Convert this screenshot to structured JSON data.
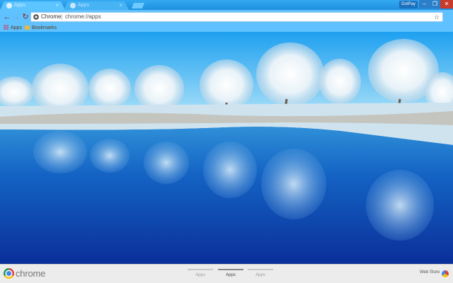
{
  "tabs": [
    {
      "title": "Apps",
      "active": true
    },
    {
      "title": "Apps",
      "active": false
    }
  ],
  "window": {
    "profile_label": "DotPay",
    "minimize_glyph": "–",
    "maximize_glyph": "❐",
    "close_glyph": "✕"
  },
  "toolbar": {
    "back_glyph": "←",
    "forward_glyph": "→",
    "reload_glyph": "↻",
    "site_chip": "Chrome",
    "url": "chrome://apps",
    "star_glyph": "☆"
  },
  "bookmarks": [
    {
      "label": "Apps",
      "icon": "apps-grid-icon"
    },
    {
      "label": "Bookmarks",
      "icon": "folder-icon"
    }
  ],
  "bottom": {
    "brand": "chrome",
    "pages": [
      {
        "label": "Apps",
        "active": false
      },
      {
        "label": "Apps",
        "active": true
      },
      {
        "label": "Apps",
        "active": false
      }
    ],
    "webstore_label": "Web Store"
  },
  "colors": {
    "frame": "#5fc1ff",
    "titlebar": "#1e8fe0",
    "close_button": "#c73b2d",
    "bottom_bar": "#ececec"
  }
}
